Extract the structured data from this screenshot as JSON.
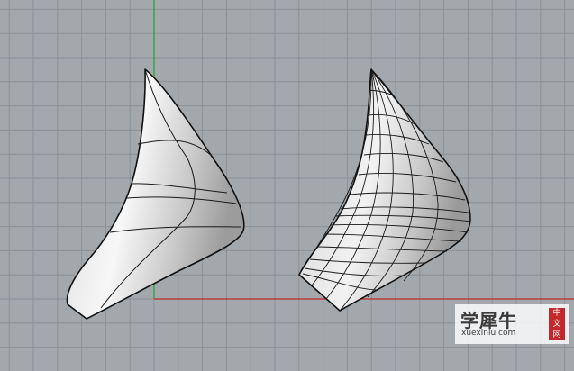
{
  "viewport": {
    "view": "perspective",
    "background_color": "#a3a8ad",
    "grid_color": "#8c9196",
    "x_axis_color": "#c0262b",
    "y_axis_color": "#1fa32b",
    "objects": [
      {
        "name": "nurbs-surface-left",
        "isocurves": "sparse"
      },
      {
        "name": "nurbs-surface-right",
        "isocurves": "dense"
      }
    ]
  },
  "watermark": {
    "cn_text": "学犀牛",
    "url": "xuexiniu.com",
    "seal_chars": [
      "中",
      "文",
      "网"
    ],
    "seal_color": "#c3282a"
  }
}
